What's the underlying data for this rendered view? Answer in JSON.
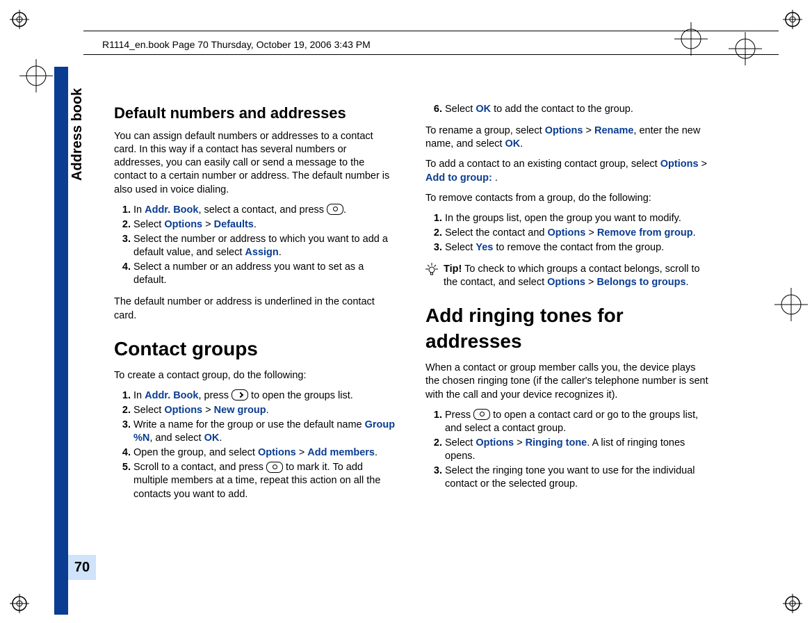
{
  "header": "R1114_en.book  Page 70  Thursday, October 19, 2006  3:43 PM",
  "section_label": "Address book",
  "page_number": "70",
  "left": {
    "h_defaults": "Default numbers and addresses",
    "p_defaults_intro": "You can assign default numbers or addresses to a contact card. In this way if a contact has several numbers or addresses, you can easily call or send a message to the contact to a certain number or address. The default number is also used in voice dialing.",
    "steps_defaults": {
      "s1a": "In ",
      "s1b": "Addr. Book",
      "s1c": ", select a contact, and press ",
      "s2a": "Select ",
      "s2b": "Options",
      "s2c": " > ",
      "s2d": "Defaults",
      "s2e": ".",
      "s3a": "Select the number or address to which you want to add a default value, and select ",
      "s3b": "Assign",
      "s3c": ".",
      "s4": "Select a number or an address you want to set as a default."
    },
    "p_defaults_note": "The default number or address is underlined in the contact card.",
    "h_groups": "Contact groups",
    "p_groups_intro": "To create a contact group, do the following:",
    "steps_groups": {
      "s1a": "In ",
      "s1b": "Addr. Book",
      "s1c": ", press ",
      "s1d": " to open the groups list.",
      "s2a": "Select ",
      "s2b": "Options",
      "s2c": " > ",
      "s2d": "New group",
      "s2e": ".",
      "s3a": "Write a name for the group or use the default name ",
      "s3b": "Group %N",
      "s3c": ", and select ",
      "s3d": "OK",
      "s3e": ".",
      "s4a": "Open the group, and select ",
      "s4b": "Options",
      "s4c": " > ",
      "s4d": "Add members",
      "s4e": ".",
      "s5a": "Scroll to a contact, and press ",
      "s5b": " to mark it. To add multiple members at a time, repeat this action on all the contacts you want to add."
    }
  },
  "right": {
    "steps_groups_cont": {
      "s6a": "Select ",
      "s6b": "OK",
      "s6c": " to add the contact to the group."
    },
    "p_rename_a": "To rename a group, select ",
    "p_rename_b": "Options",
    "p_rename_c": " > ",
    "p_rename_d": "Rename",
    "p_rename_e": ", enter the new name, and select ",
    "p_rename_f": "OK",
    "p_rename_g": ".",
    "p_addto_a": "To add a contact to an existing contact group, select ",
    "p_addto_b": "Options",
    "p_addto_c": " > ",
    "p_addto_d": "Add to group:",
    "p_addto_e": " .",
    "p_remove_intro": "To remove contacts from a group, do the following:",
    "steps_remove": {
      "s1": "In the groups list, open the group you want to modify.",
      "s2a": "Select the contact and ",
      "s2b": "Options",
      "s2c": " > ",
      "s2d": "Remove from group",
      "s2e": ".",
      "s3a": "Select ",
      "s3b": "Yes",
      "s3c": " to remove the contact from the group."
    },
    "tip_label": "Tip!",
    "tip_a": " To check to which groups a contact belongs, scroll to the contact, and select ",
    "tip_b": "Options",
    "tip_c": " > ",
    "tip_d": "Belongs to groups",
    "tip_e": ".",
    "h_tones": "Add ringing tones for addresses",
    "p_tones_intro": "When a contact or group member calls you, the device plays the chosen ringing tone (if the caller's telephone number is sent with the call and your device recognizes it).",
    "steps_tones": {
      "s1a": "Press ",
      "s1b": " to open a contact card or go to the groups list, and select a contact group.",
      "s2a": "Select ",
      "s2b": "Options",
      "s2c": " > ",
      "s2d": "Ringing tone",
      "s2e": ". A list of ringing tones opens.",
      "s3": "Select the ringing tone you want to use for the individual contact or the selected group."
    }
  }
}
